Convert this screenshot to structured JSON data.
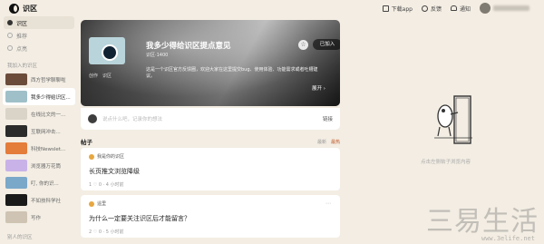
{
  "app": {
    "name": "识区"
  },
  "topbar": {
    "download": "下载app",
    "feedback": "反馈",
    "notify": "通知"
  },
  "sidebar": {
    "nav": [
      {
        "label": "识区",
        "active": true
      },
      {
        "label": "推荐",
        "active": false
      },
      {
        "label": "点亮",
        "active": false
      }
    ],
    "section_mine": "我加入的识区",
    "communities": [
      {
        "label": "西方哲学聊聊啦",
        "color": "#6b4c3b",
        "active": false
      },
      {
        "label": "我多少得给识区...",
        "color": "#9fc0c8",
        "active": true
      },
      {
        "label": "在线比文的一...",
        "color": "#d9d3c8",
        "active": false
      },
      {
        "label": "互联网冲击...",
        "color": "#2b2b2b",
        "active": false
      },
      {
        "label": "科技Newslet...",
        "color": "#e47c3a",
        "active": false
      },
      {
        "label": "浏览器万花筒",
        "color": "#c9b2e8",
        "active": false
      },
      {
        "label": "叮, 你的识...",
        "color": "#7aa8c9",
        "active": false
      },
      {
        "label": "不如技科学社",
        "color": "#1a1a1a",
        "active": false
      },
      {
        "label": "写作",
        "color": "#cfc4b3",
        "active": false
      }
    ],
    "section_more": "别人的识区"
  },
  "banner": {
    "title": "我多少得给识区提点意见",
    "meta": "识区·1400",
    "desc": "这是一个识区官方反馈圈，欢迎大家在这里提交bug、使用体验、功能需求或者吐槽建议。",
    "tags": [
      "创作",
      "识区"
    ],
    "expand": "展开 ›",
    "join": "已加入",
    "star": "☆"
  },
  "compose": {
    "placeholder": "说点什么吧，记录你的想法",
    "link": "链接"
  },
  "posts": {
    "title": "帖子",
    "sort": [
      "最新",
      "最热"
    ],
    "items": [
      {
        "author": "我是你的识区",
        "title": "长页推文浏览降级",
        "stats": "1 ♡ 0 · 4 小时前"
      },
      {
        "author": "遥里",
        "title": "为什么一定要关注识区后才能留言？",
        "stats": "2 ♡ 0 · 5 小时前"
      }
    ]
  },
  "right": {
    "empty": "点击左侧帖子浏览内容"
  },
  "watermark": {
    "text": "三易生活",
    "url": "www.3elife.net"
  }
}
